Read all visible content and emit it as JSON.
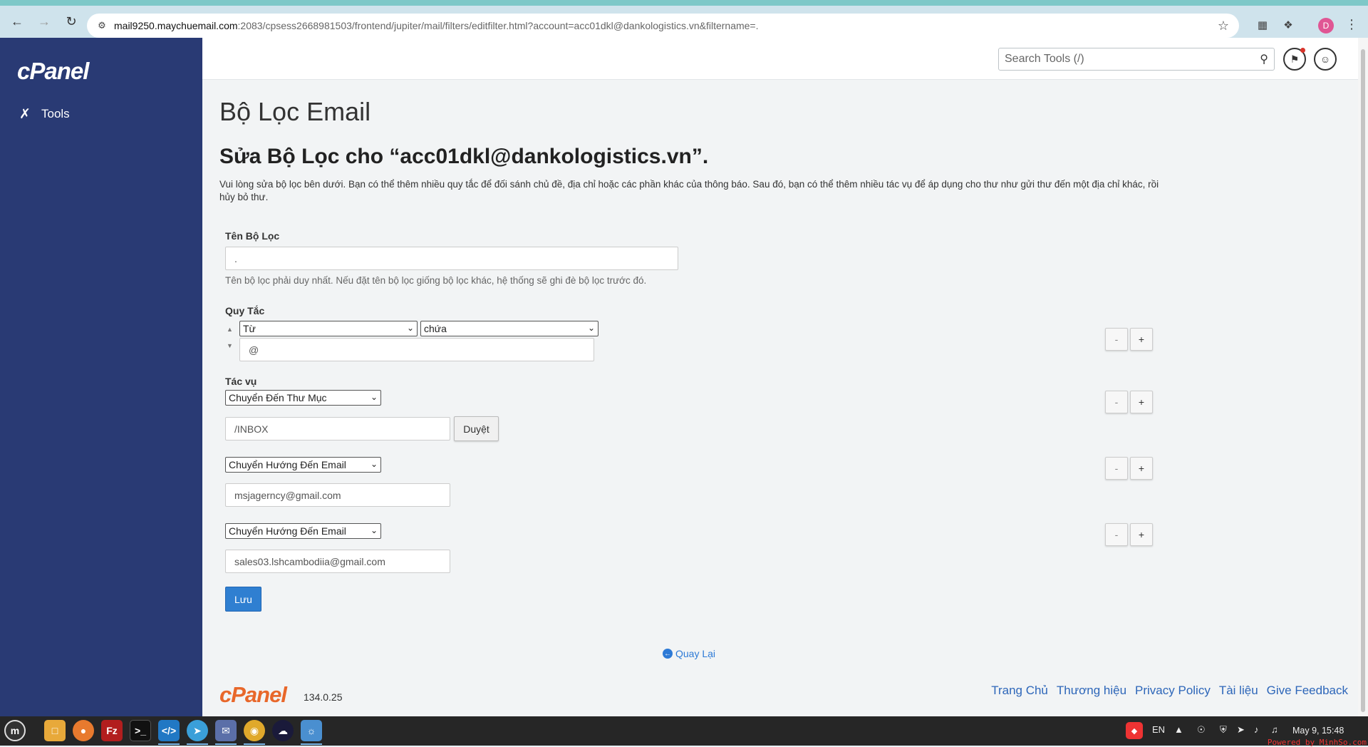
{
  "browser": {
    "url_host": "mail9250.maychuemail.com",
    "url_path": ":2083/cpsess2668981503/frontend/jupiter/mail/filters/editfilter.html?account=acc01dkl@dankologistics.vn&filtername=.",
    "profile_initial": "D"
  },
  "sidebar": {
    "logo": "cPanel",
    "items": [
      {
        "label": "Tools"
      }
    ]
  },
  "topbar": {
    "search_placeholder": "Search Tools (/)"
  },
  "page": {
    "title": "Bộ Lọc Email",
    "subtitle": "Sửa Bộ Lọc cho “acc01dkl@dankologistics.vn”.",
    "description": "Vui lòng sửa bộ lọc bên dưới. Bạn có thể thêm nhiều quy tắc để đối sánh chủ đề, địa chỉ hoặc các phần khác của thông báo. Sau đó, bạn có thể thêm nhiều tác vụ để áp dụng cho thư như gửi thư đến một địa chỉ khác, rồi hủy bỏ thư."
  },
  "form": {
    "filter_name_label": "Tên Bộ Lọc",
    "filter_name_value": ".",
    "filter_name_help": "Tên bộ lọc phải duy nhất. Nếu đặt tên bộ lọc giống bộ lọc khác, hệ thống sẽ ghi đè bộ lọc trước đó.",
    "rules_label": "Quy Tắc",
    "rule": {
      "field": "Từ",
      "operator": "chứa",
      "value": "@"
    },
    "actions_label": "Tác vụ",
    "actions": [
      {
        "type": "Chuyển Đến Thư Mục",
        "value": "/INBOX"
      },
      {
        "type": "Chuyển Hướng Đến Email",
        "value": "msjagerncy@gmail.com"
      },
      {
        "type": "Chuyển Hướng Đến Email",
        "value": "sales03.lshcambodiia@gmail.com"
      }
    ],
    "browse_label": "Duyệt",
    "minus_label": "-",
    "plus_label": "+",
    "save_label": "Lưu"
  },
  "back_link": "Quay Lại",
  "footer": {
    "logo": "cPanel",
    "version": "134.0.25",
    "links": [
      "Trang Chủ",
      "Thương hiệu",
      "Privacy Policy",
      "Tài liệu",
      "Give Feedback"
    ]
  },
  "taskbar": {
    "lang": "EN",
    "clock": "May  9, 15:48",
    "powered": "Powered by MinhSo.com"
  }
}
